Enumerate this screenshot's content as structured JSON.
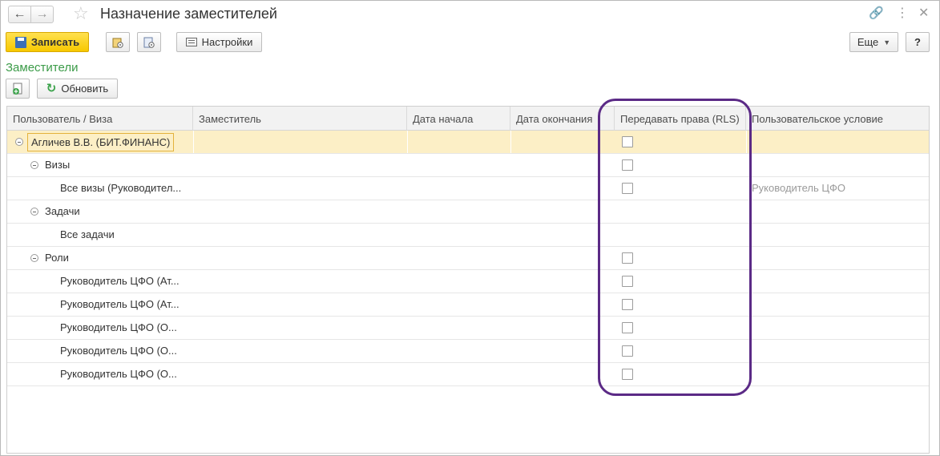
{
  "window": {
    "title": "Назначение заместителей"
  },
  "toolbar": {
    "save_label": "Записать",
    "settings_label": "Настройки",
    "more_label": "Еще",
    "help_label": "?"
  },
  "section": {
    "title": "Заместители",
    "refresh_label": "Обновить"
  },
  "table": {
    "columns": [
      "Пользователь / Виза",
      "Заместитель",
      "Дата начала",
      "Дата окончания",
      "Передавать права (RLS)",
      "Пользовательское условие"
    ],
    "rows": [
      {
        "label": "Агличев В.В. (БИТ.ФИНАНС)",
        "condition": ""
      },
      {
        "label": "Визы",
        "condition": ""
      },
      {
        "label": "Все визы (Руководител...",
        "condition": "Руководитель ЦФО"
      },
      {
        "label": "Задачи",
        "condition": ""
      },
      {
        "label": "Все задачи",
        "condition": ""
      },
      {
        "label": "Роли",
        "condition": ""
      },
      {
        "label": "Руководитель ЦФО (Ат...",
        "condition": ""
      },
      {
        "label": "Руководитель ЦФО (Ат...",
        "condition": ""
      },
      {
        "label": "Руководитель ЦФО (О...",
        "condition": ""
      },
      {
        "label": "Руководитель ЦФО (О...",
        "condition": ""
      },
      {
        "label": "Руководитель ЦФО (О...",
        "condition": ""
      }
    ]
  },
  "colors": {
    "accent_yellow": "#f7c800",
    "section_green": "#3b9b48",
    "highlight_purple": "#5b2a86",
    "selected_row": "#fcefc6"
  },
  "icons": [
    "back-arrow-icon",
    "forward-arrow-icon",
    "star-icon",
    "link-icon",
    "more-vert-icon",
    "close-icon",
    "save-icon",
    "settings-icon",
    "refresh-icon",
    "add-icon"
  ]
}
